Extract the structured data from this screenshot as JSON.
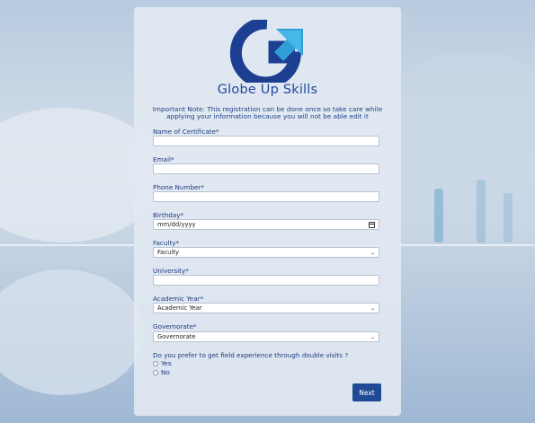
{
  "brand": {
    "name": "Globe Up Skills",
    "logo_icon": "globe-up-skills-logo"
  },
  "note": "Important Note: This registration can be done once so take care while applying your information because you will not be able edit it",
  "fields": {
    "certificate_name": {
      "label": "Name of Certificate*",
      "value": ""
    },
    "email": {
      "label": "Email*",
      "value": ""
    },
    "phone": {
      "label": "Phone Number*",
      "value": ""
    },
    "birthday": {
      "label": "Birthday*",
      "value": "mm/dd/yyyy"
    },
    "faculty": {
      "label": "Faculty*",
      "value": "Faculty"
    },
    "university": {
      "label": "University*",
      "value": ""
    },
    "academic_year": {
      "label": "Academic Year*",
      "value": "Academic Year"
    },
    "governorate": {
      "label": "Governorate*",
      "value": "Governorate"
    }
  },
  "question": {
    "label": "Do you prefer to get field experience through double visits ?",
    "options": [
      "Yes",
      "No"
    ]
  },
  "next_label": "Next",
  "colors": {
    "accent": "#1f4a96",
    "brand_text": "#1f4aa0",
    "label_text": "#1e3a7d"
  }
}
